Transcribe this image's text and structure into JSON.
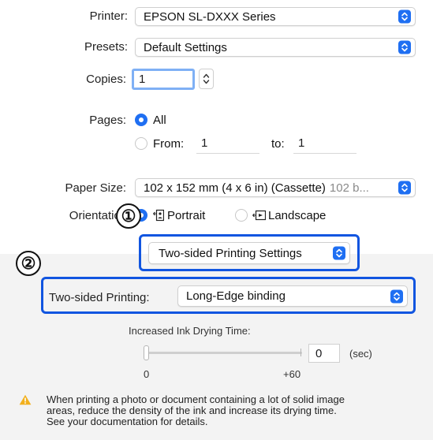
{
  "printer": {
    "label": "Printer:",
    "value": "EPSON SL-DXXX Series"
  },
  "presets": {
    "label": "Presets:",
    "value": "Default Settings"
  },
  "copies": {
    "label": "Copies:",
    "value": "1"
  },
  "pages": {
    "label": "Pages:",
    "all_label": "All",
    "from_label": "From:",
    "from_value": "1",
    "to_label": "to:",
    "to_value": "1",
    "selected": "All"
  },
  "paper_size": {
    "label": "Paper Size:",
    "value": "102 x 152 mm (4 x 6 in) (Cassette)",
    "value_suffix": "102 b..."
  },
  "orientation": {
    "label": "Orientatic",
    "portrait_label": "Portrait",
    "landscape_label": "Landscape"
  },
  "section_popup": {
    "value": "Two-sided Printing Settings"
  },
  "two_sided": {
    "label": "Two-sided Printing:",
    "value": "Long-Edge binding"
  },
  "drying": {
    "title": "Increased Ink Drying Time:",
    "value": "0",
    "unit": "(sec)",
    "min_label": "0",
    "max_label": "+60",
    "level": 0
  },
  "warning": {
    "icon": "warning-triangle-icon",
    "text_line1": "When printing a photo or document containing a lot of solid image",
    "text_line2": "areas, reduce the density of the ink and increase its drying time.",
    "text_line3": "See your documentation for details."
  },
  "callouts": {
    "one": "①",
    "two": "②"
  },
  "colors": {
    "accent": "#1f6ff2",
    "callout": "#1155e0",
    "warning": "#f2b01e"
  }
}
